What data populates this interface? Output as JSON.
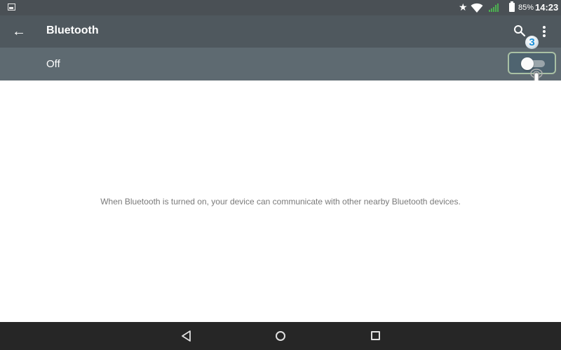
{
  "status_bar": {
    "icons": [
      "gallery-icon",
      "star-icon",
      "wifi-icon",
      "signal-icon",
      "battery-icon"
    ],
    "star_glyph": "★",
    "battery_percent": "85%",
    "time": "14:23",
    "signal_color": "#4caf50"
  },
  "app_bar": {
    "back_glyph": "←",
    "title": "Bluetooth",
    "actions": [
      "search-icon",
      "more-options-icon"
    ]
  },
  "toggle_row": {
    "label": "Off",
    "switch_state": "off"
  },
  "annotation": {
    "step_number": "3",
    "pointer": "hand-pointer-icon"
  },
  "content": {
    "info_text": "When Bluetooth is turned on, your device can communicate with other nearby Bluetooth devices."
  },
  "nav_bar": {
    "buttons": [
      "back",
      "home",
      "recents"
    ]
  },
  "colors": {
    "status_bar_bg": "#4a5055",
    "app_bar_bg": "#4f585e",
    "toggle_row_bg": "#5e6a71",
    "nav_bar_bg": "#262626",
    "highlight_border": "#a9c0a4",
    "badge_number": "#1a8fd8"
  }
}
